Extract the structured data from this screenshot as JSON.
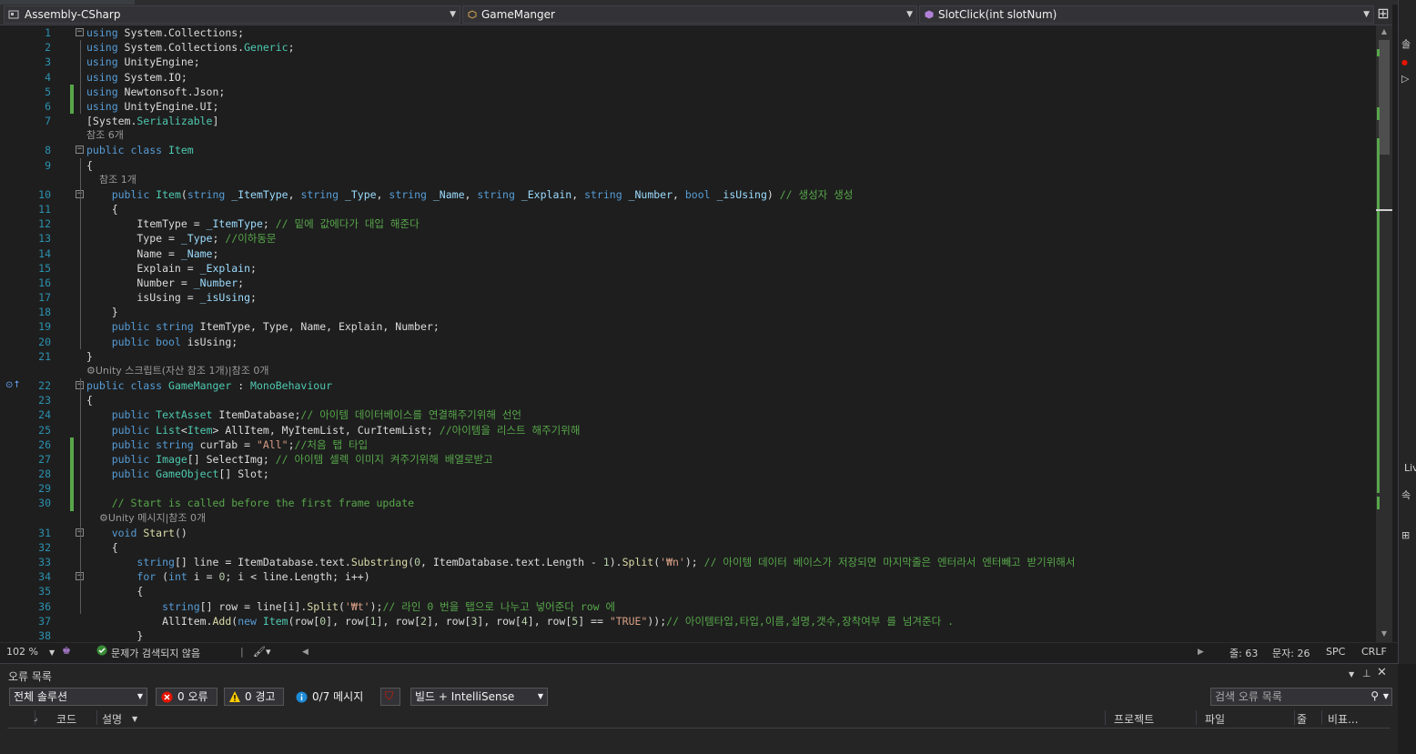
{
  "nav": {
    "project": "Assembly-CSharp",
    "class": "GameManger",
    "member": "SlotClick(int slotNum)"
  },
  "right_strip": {
    "t1": "솔",
    "t2": "Liv",
    "t3": "속"
  },
  "code_lines": [
    {
      "n": "1",
      "tokens": [
        [
          "kw",
          "using"
        ],
        [
          "id",
          " System.Collections;"
        ]
      ]
    },
    {
      "n": "2",
      "tokens": [
        [
          "kw",
          "using"
        ],
        [
          "id",
          " System.Collections."
        ],
        [
          "ty",
          "Generic"
        ],
        [
          "id",
          ";"
        ]
      ]
    },
    {
      "n": "3",
      "tokens": [
        [
          "kw",
          "using"
        ],
        [
          "id",
          " UnityEngine;"
        ]
      ]
    },
    {
      "n": "4",
      "tokens": [
        [
          "kw",
          "using"
        ],
        [
          "id",
          " System.IO;"
        ]
      ]
    },
    {
      "n": "5",
      "tokens": [
        [
          "kw",
          "using"
        ],
        [
          "id",
          " Newtonsoft.Json;"
        ]
      ]
    },
    {
      "n": "6",
      "tokens": [
        [
          "kw",
          "using"
        ],
        [
          "id",
          " UnityEngine.UI;"
        ]
      ]
    },
    {
      "n": "7",
      "tokens": [
        [
          "id",
          "[System."
        ],
        [
          "ty",
          "Serializable"
        ],
        [
          "id",
          "]"
        ]
      ]
    },
    {
      "lens": "참조 6개"
    },
    {
      "n": "8",
      "tokens": [
        [
          "kw",
          "public class "
        ],
        [
          "ty",
          "Item"
        ]
      ]
    },
    {
      "n": "9",
      "tokens": [
        [
          "id",
          "{"
        ]
      ]
    },
    {
      "lens": "    참조 1개"
    },
    {
      "n": "10",
      "tokens": [
        [
          "id",
          "    "
        ],
        [
          "kw",
          "public "
        ],
        [
          "ty",
          "Item"
        ],
        [
          "id",
          "("
        ],
        [
          "kw",
          "string "
        ],
        [
          "prm",
          "_ItemType"
        ],
        [
          "id",
          ", "
        ],
        [
          "kw",
          "string "
        ],
        [
          "prm",
          "_Type"
        ],
        [
          "id",
          ", "
        ],
        [
          "kw",
          "string "
        ],
        [
          "prm",
          "_Name"
        ],
        [
          "id",
          ", "
        ],
        [
          "kw",
          "string "
        ],
        [
          "prm",
          "_Explain"
        ],
        [
          "id",
          ", "
        ],
        [
          "kw",
          "string "
        ],
        [
          "prm",
          "_Number"
        ],
        [
          "id",
          ", "
        ],
        [
          "kw",
          "bool "
        ],
        [
          "prm",
          "_isUsing"
        ],
        [
          "id",
          ") "
        ],
        [
          "cm",
          "// 생성자 생성"
        ]
      ]
    },
    {
      "n": "11",
      "tokens": [
        [
          "id",
          "    {"
        ]
      ]
    },
    {
      "n": "12",
      "tokens": [
        [
          "id",
          "        ItemType = "
        ],
        [
          "prm",
          "_ItemType"
        ],
        [
          "id",
          "; "
        ],
        [
          "cm",
          "// 밑에 값에다가 대입 해준다"
        ]
      ]
    },
    {
      "n": "13",
      "tokens": [
        [
          "id",
          "        Type = "
        ],
        [
          "prm",
          "_Type"
        ],
        [
          "id",
          "; "
        ],
        [
          "cm",
          "//이하동문"
        ]
      ]
    },
    {
      "n": "14",
      "tokens": [
        [
          "id",
          "        Name = "
        ],
        [
          "prm",
          "_Name"
        ],
        [
          "id",
          ";"
        ]
      ]
    },
    {
      "n": "15",
      "tokens": [
        [
          "id",
          "        Explain = "
        ],
        [
          "prm",
          "_Explain"
        ],
        [
          "id",
          ";"
        ]
      ]
    },
    {
      "n": "16",
      "tokens": [
        [
          "id",
          "        Number = "
        ],
        [
          "prm",
          "_Number"
        ],
        [
          "id",
          ";"
        ]
      ]
    },
    {
      "n": "17",
      "tokens": [
        [
          "id",
          "        isUsing = "
        ],
        [
          "prm",
          "_isUsing"
        ],
        [
          "id",
          ";"
        ]
      ]
    },
    {
      "n": "18",
      "tokens": [
        [
          "id",
          "    }"
        ]
      ]
    },
    {
      "n": "19",
      "tokens": [
        [
          "id",
          "    "
        ],
        [
          "kw",
          "public string "
        ],
        [
          "id",
          "ItemType, Type, Name, Explain, Number;"
        ]
      ]
    },
    {
      "n": "20",
      "tokens": [
        [
          "id",
          "    "
        ],
        [
          "kw",
          "public bool "
        ],
        [
          "id",
          "isUsing;"
        ]
      ]
    },
    {
      "n": "21",
      "tokens": [
        [
          "id",
          "}"
        ]
      ]
    },
    {
      "lens": "⚙Unity 스크립트(자산 참조 1개)|참조 0개"
    },
    {
      "n": "22",
      "tokens": [
        [
          "kw",
          "public class "
        ],
        [
          "ty",
          "GameManger"
        ],
        [
          "id",
          " : "
        ],
        [
          "ty",
          "MonoBehaviour"
        ]
      ]
    },
    {
      "n": "23",
      "tokens": [
        [
          "id",
          "{"
        ]
      ]
    },
    {
      "n": "24",
      "tokens": [
        [
          "id",
          "    "
        ],
        [
          "kw",
          "public "
        ],
        [
          "ty",
          "TextAsset"
        ],
        [
          "id",
          " ItemDatabase;"
        ],
        [
          "cm",
          "// 아이템 데이터베이스를 연결해주기위해 선언"
        ]
      ]
    },
    {
      "n": "25",
      "tokens": [
        [
          "id",
          "    "
        ],
        [
          "kw",
          "public "
        ],
        [
          "ty",
          "List"
        ],
        [
          "id",
          "<"
        ],
        [
          "ty",
          "Item"
        ],
        [
          "id",
          "> AllItem, MyItemList, CurItemList; "
        ],
        [
          "cm",
          "//아이템을 리스트 해주기위해"
        ]
      ]
    },
    {
      "n": "26",
      "tokens": [
        [
          "id",
          "    "
        ],
        [
          "kw",
          "public string "
        ],
        [
          "id",
          "curTab = "
        ],
        [
          "st",
          "\"All\""
        ],
        [
          "id",
          ";"
        ],
        [
          "cm",
          "//처음 탭 타입"
        ]
      ]
    },
    {
      "n": "27",
      "tokens": [
        [
          "id",
          "    "
        ],
        [
          "kw",
          "public "
        ],
        [
          "ty",
          "Image"
        ],
        [
          "id",
          "[] SelectImg; "
        ],
        [
          "cm",
          "// 아이템 셀렉 이미지 켜주기위해 배열로받고"
        ]
      ]
    },
    {
      "n": "28",
      "tokens": [
        [
          "id",
          "    "
        ],
        [
          "kw",
          "public "
        ],
        [
          "ty",
          "GameObject"
        ],
        [
          "id",
          "[] Slot;"
        ]
      ]
    },
    {
      "n": "29",
      "tokens": [
        [
          "id",
          ""
        ]
      ]
    },
    {
      "n": "30",
      "tokens": [
        [
          "id",
          "    "
        ],
        [
          "cm",
          "// Start is called before the first frame update"
        ]
      ]
    },
    {
      "lens": "    ⚙Unity 메시지|참조 0개"
    },
    {
      "n": "31",
      "tokens": [
        [
          "id",
          "    "
        ],
        [
          "kw",
          "void "
        ],
        [
          "mt",
          "Start"
        ],
        [
          "id",
          "()"
        ]
      ]
    },
    {
      "n": "32",
      "tokens": [
        [
          "id",
          "    {"
        ]
      ]
    },
    {
      "n": "33",
      "tokens": [
        [
          "id",
          "        "
        ],
        [
          "kw",
          "string"
        ],
        [
          "id",
          "[] line = ItemDatabase.text."
        ],
        [
          "mt",
          "Substring"
        ],
        [
          "id",
          "("
        ],
        [
          "nm",
          "0"
        ],
        [
          "id",
          ", ItemDatabase.text.Length - "
        ],
        [
          "nm",
          "1"
        ],
        [
          "id",
          ")."
        ],
        [
          "mt",
          "Split"
        ],
        [
          "id",
          "("
        ],
        [
          "st",
          "'₩n'"
        ],
        [
          "id",
          "); "
        ],
        [
          "cm",
          "// 아이템 데이터 베이스가 저장되면 마지막줄은 엔터라서 엔터빼고 받기위해서"
        ]
      ]
    },
    {
      "n": "34",
      "tokens": [
        [
          "id",
          "        "
        ],
        [
          "kw",
          "for "
        ],
        [
          "id",
          "("
        ],
        [
          "kw",
          "int "
        ],
        [
          "id",
          "i = "
        ],
        [
          "nm",
          "0"
        ],
        [
          "id",
          "; i < line.Length; i++)"
        ]
      ]
    },
    {
      "n": "35",
      "tokens": [
        [
          "id",
          "        {"
        ]
      ]
    },
    {
      "n": "36",
      "tokens": [
        [
          "id",
          "            "
        ],
        [
          "kw",
          "string"
        ],
        [
          "id",
          "[] row = line[i]."
        ],
        [
          "mt",
          "Split"
        ],
        [
          "id",
          "("
        ],
        [
          "st",
          "'₩t'"
        ],
        [
          "id",
          ");"
        ],
        [
          "cm",
          "// 라인 0 번을 탭으로 나누고 넣어준다 row 에"
        ]
      ]
    },
    {
      "n": "37",
      "tokens": [
        [
          "id",
          "            AllItem."
        ],
        [
          "mt",
          "Add"
        ],
        [
          "id",
          "("
        ],
        [
          "kw",
          "new "
        ],
        [
          "ty",
          "Item"
        ],
        [
          "id",
          "(row["
        ],
        [
          "nm",
          "0"
        ],
        [
          "id",
          "], row["
        ],
        [
          "nm",
          "1"
        ],
        [
          "id",
          "], row["
        ],
        [
          "nm",
          "2"
        ],
        [
          "id",
          "], row["
        ],
        [
          "nm",
          "3"
        ],
        [
          "id",
          "], row["
        ],
        [
          "nm",
          "4"
        ],
        [
          "id",
          "], row["
        ],
        [
          "nm",
          "5"
        ],
        [
          "id",
          "] == "
        ],
        [
          "st",
          "\"TRUE\""
        ],
        [
          "id",
          "));"
        ],
        [
          "cm",
          "// 아이템타입,타입,이름,설명,갯수,장착여부 를 넘겨준다 ."
        ]
      ]
    },
    {
      "n": "38",
      "tokens": [
        [
          "id",
          "        }"
        ]
      ]
    }
  ],
  "status": {
    "zoom": "102 %",
    "issues": "문제가 검색되지 않음",
    "line": "줄: 63",
    "char": "문자: 26",
    "spc": "SPC",
    "eol": "CRLF"
  },
  "error_list": {
    "title": "오류 목록 ",
    "scope": "전체 솔루션",
    "errors": "0 오류",
    "warnings": "0 경고",
    "messages": "0/7 메시지",
    "build": "빌드 + IntelliSense",
    "search_placeholder": "검색 오류 목록",
    "columns": {
      "code": "코드",
      "desc": "설명",
      "project": "프로젝트",
      "file": "파일",
      "line": "줄",
      "suppress": "비표..."
    }
  },
  "colors": {
    "accent_green": "#57a64a",
    "keyword": "#569cd6",
    "type": "#4ec9b0",
    "error": "#e51400",
    "warning": "#ffcc00",
    "info": "#1e8ad6"
  }
}
